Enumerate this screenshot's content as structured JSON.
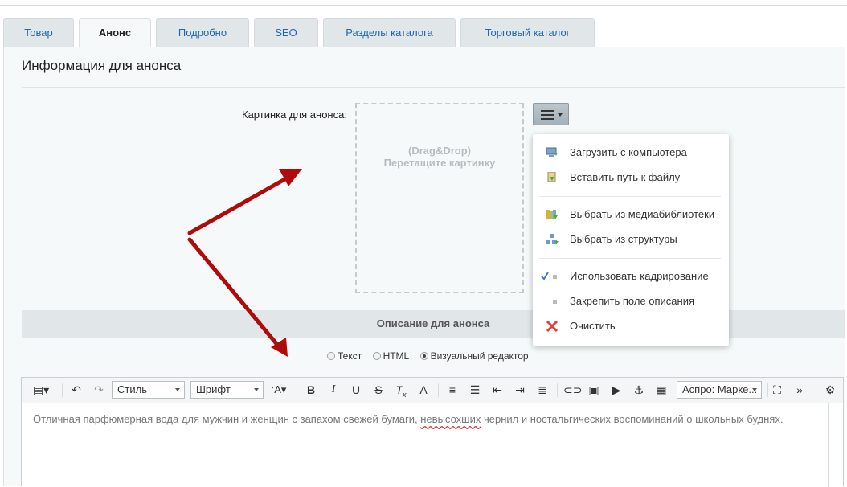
{
  "tabs": [
    "Товар",
    "Анонс",
    "Подробно",
    "SEO",
    "Разделы каталога",
    "Торговый каталог"
  ],
  "active_tab": "Анонс",
  "section_title": "Информация для анонса",
  "picture": {
    "label": "Картинка для анонса:",
    "dropzone_line1": "(Drag&Drop)",
    "dropzone_line2": "Перетащите картинку"
  },
  "menu": {
    "items": [
      {
        "label": "Загрузить с компьютера",
        "icon": "computer-upload-icon"
      },
      {
        "label": "Вставить путь к файлу",
        "icon": "file-path-icon"
      },
      {
        "label": "Выбрать из медиабиблиотеки",
        "icon": "media-library-icon"
      },
      {
        "label": "Выбрать из структуры",
        "icon": "structure-icon"
      },
      {
        "label": "Использовать кадрирование",
        "icon": "check-icon",
        "checked": true
      },
      {
        "label": "Закрепить поле описания",
        "icon": "dot-icon"
      },
      {
        "label": "Очистить",
        "icon": "clear-icon"
      }
    ]
  },
  "description": {
    "title": "Описание для анонса",
    "modes": [
      {
        "label": "Текст",
        "selected": false
      },
      {
        "label": "HTML",
        "selected": false
      },
      {
        "label": "Визуальный редактор",
        "selected": true
      }
    ]
  },
  "editor": {
    "style_select": "Стиль",
    "font_select": "Шрифт",
    "template_select": "Аспро: Марке...",
    "content_before": "Отличная парфюмерная вода для мужчин и женщин с запахом свежей бумаги, ",
    "content_misspelled": "невысохших",
    "content_after": " чернил и ностальгических воспоминаний о школьных буднях."
  },
  "colors": {
    "accent_link": "#2067b0",
    "arrow": "#b00a0a",
    "tab_bg": "#e1e6e8",
    "panel_bg": "#f5f9f9"
  }
}
